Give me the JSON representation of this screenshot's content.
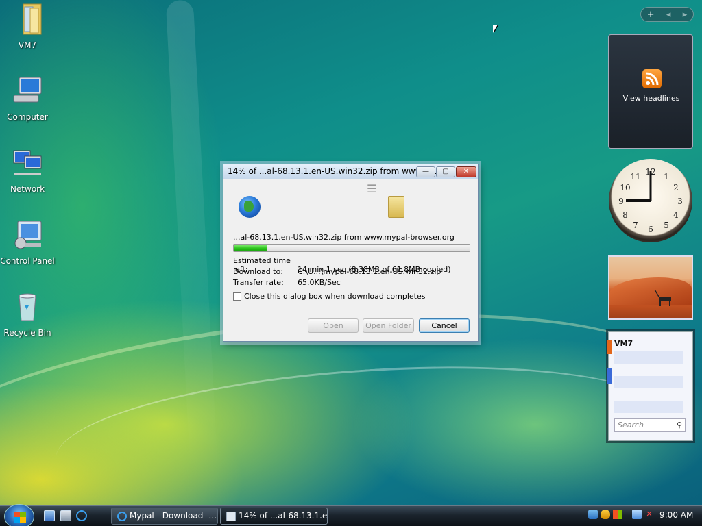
{
  "desktop": {
    "icons": [
      {
        "label": "VM7",
        "icon": "folder-icon"
      },
      {
        "label": "Computer",
        "icon": "computer-icon"
      },
      {
        "label": "Network",
        "icon": "network-icon"
      },
      {
        "label": "Control Panel",
        "icon": "control-panel-icon"
      },
      {
        "label": "Recycle Bin",
        "icon": "recycle-bin-icon"
      }
    ]
  },
  "sidebar": {
    "top_controls": {
      "add": "+",
      "prev": "◂",
      "next": "▸"
    },
    "feed_gadget": {
      "label": "View headlines",
      "icon": "rss-icon"
    },
    "clock_gadget": {
      "numbers": [
        "12",
        "1",
        "2",
        "3",
        "4",
        "5",
        "6",
        "7",
        "8",
        "9",
        "10",
        "11"
      ],
      "time": "9:00"
    },
    "contacts_gadget": {
      "title": "VM7",
      "search_placeholder": "Search"
    }
  },
  "dialog": {
    "title": "14% of ...al-68.13.1.en-US.win32.zip from www.m...",
    "file_line": "...al-68.13.1.en-US.win32.zip from www.mypal-browser.org",
    "progress_percent": 14,
    "estimated_label": "Estimated time left:",
    "estimated_value": "14 min 1 sec (8.38MB of 61.8MB copied)",
    "download_to_label": "Download to:",
    "download_to_value": "C:\\U...\\mypal-68.13.1.en-US.win32.zip",
    "rate_label": "Transfer rate:",
    "rate_value": "65.0KB/Sec",
    "checkbox_label": "Close this dialog box when download completes",
    "buttons": {
      "open": "Open",
      "open_folder": "Open Folder",
      "cancel": "Cancel"
    },
    "window_buttons": {
      "minimize": "—",
      "maximize": "▢",
      "close": "✕"
    }
  },
  "taskbar": {
    "tasks": [
      {
        "label": "Mypal - Download -...",
        "icon": "ie-icon"
      },
      {
        "label": "14% of ...al-68.13.1.e...",
        "icon": "download-window-icon"
      }
    ],
    "clock": "9:00 AM"
  },
  "colors": {
    "progress": "#2cc41c",
    "taskbar": "#1b242d",
    "title_close": "#c0392b"
  }
}
